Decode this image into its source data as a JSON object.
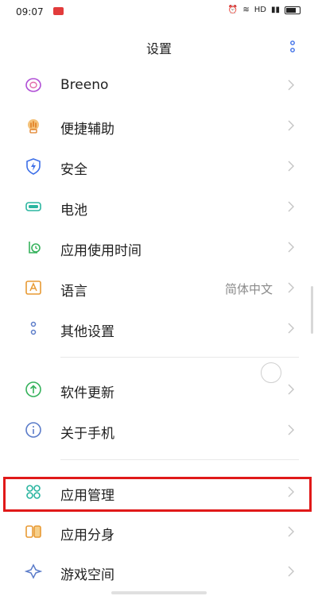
{
  "status_bar": {
    "time": "09:07",
    "network": "HD"
  },
  "header": {
    "title": "设置"
  },
  "items": [
    {
      "label": "Breeno",
      "value": "",
      "icon": "breeno-icon",
      "color": "#b04fd6"
    },
    {
      "label": "便捷辅助",
      "value": "",
      "icon": "hand-icon",
      "color": "#e89a34"
    },
    {
      "label": "安全",
      "value": "",
      "icon": "shield-icon",
      "color": "#3d6fe8"
    },
    {
      "label": "电池",
      "value": "",
      "icon": "battery-icon",
      "color": "#2bb5a0"
    },
    {
      "label": "应用使用时间",
      "value": "",
      "icon": "screen-time-icon",
      "color": "#36b25c"
    },
    {
      "label": "语言",
      "value": "简体中文",
      "icon": "language-icon",
      "color": "#e89a34"
    },
    {
      "label": "其他设置",
      "value": "",
      "icon": "other-settings-icon",
      "color": "#5b7cc9"
    },
    {
      "label": "软件更新",
      "value": "",
      "icon": "update-icon",
      "color": "#36b25c"
    },
    {
      "label": "关于手机",
      "value": "",
      "icon": "info-icon",
      "color": "#5b7cc9"
    },
    {
      "label": "应用管理",
      "value": "",
      "icon": "app-manage-icon",
      "color": "#2bb5a0"
    },
    {
      "label": "应用分身",
      "value": "",
      "icon": "app-clone-icon",
      "color": "#e89a34"
    },
    {
      "label": "游戏空间",
      "value": "",
      "icon": "game-space-icon",
      "color": "#5b7cc9"
    }
  ],
  "colors": {
    "highlight": "#e01919",
    "accent": "#3d6fe8"
  }
}
